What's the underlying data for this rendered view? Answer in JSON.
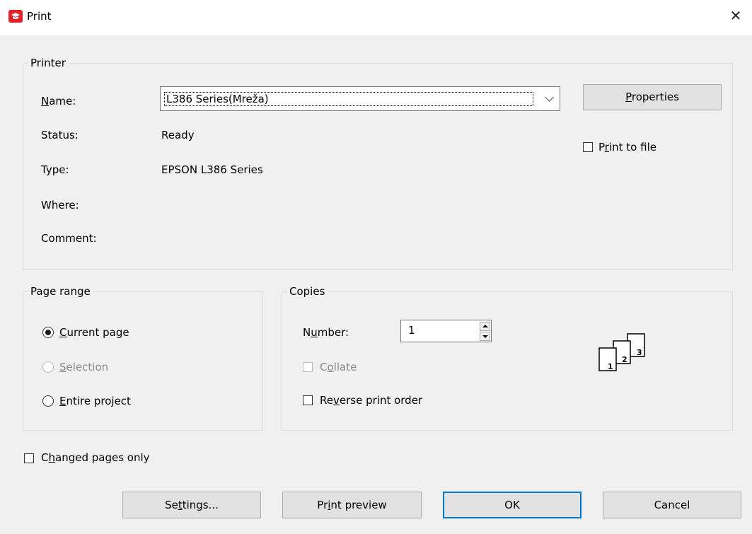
{
  "window": {
    "title": "Print",
    "close_glyph": "✕"
  },
  "printer": {
    "legend": "Printer",
    "name_label": "Name:",
    "name_value": "L386 Series(Mreža)",
    "status_label": "Status:",
    "status_value": "Ready",
    "type_label": "Type:",
    "type_value": "EPSON L386 Series",
    "where_label": "Where:",
    "where_value": "",
    "comment_label": "Comment:",
    "comment_value": "",
    "properties_button": "Properties",
    "print_to_file": "Print to file"
  },
  "page_range": {
    "legend": "Page range",
    "options": [
      {
        "label": "Current page",
        "checked": true,
        "enabled": true
      },
      {
        "label": "Selection",
        "checked": false,
        "enabled": false
      },
      {
        "label": "Entire project",
        "checked": false,
        "enabled": true
      }
    ]
  },
  "copies": {
    "legend": "Copies",
    "number_label": "Number:",
    "number_value": "1",
    "collate": "Collate",
    "reverse": "Reverse print order",
    "collate_pages": [
      "1",
      "2",
      "3"
    ]
  },
  "changed_pages_only": "Changed pages only",
  "buttons": {
    "settings": "Settings...",
    "preview": "Print preview",
    "ok": "OK",
    "cancel": "Cancel"
  },
  "colors": {
    "accent": "#0078d7",
    "app_icon": "#e5202a",
    "dialog_bg": "#f0f0f0"
  }
}
